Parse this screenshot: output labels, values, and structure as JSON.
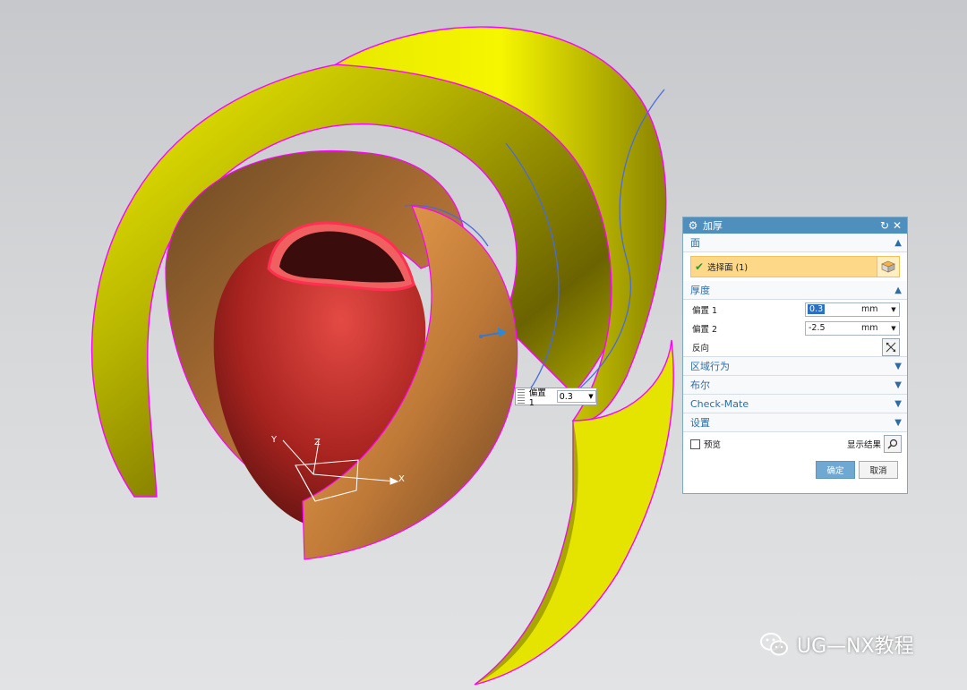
{
  "dialog": {
    "title": "加厚",
    "icons": {
      "title": "gear-icon",
      "reset": "reset-icon",
      "close": "close-icon"
    },
    "section_face": "面",
    "select_face_label": "选择面 (1)",
    "section_thickness": "厚度",
    "offset1_label": "偏置 1",
    "offset1_value": "0.3",
    "offset1_unit": "mm",
    "offset2_label": "偏置 2",
    "offset2_value": "-2.5",
    "offset2_unit": "mm",
    "reverse_label": "反向",
    "section_region": "区域行为",
    "section_boolean": "布尔",
    "section_checkmate": "Check-Mate",
    "section_settings": "设置",
    "preview_label": "预览",
    "show_result_label": "显示结果",
    "ok_label": "确定",
    "cancel_label": "取消"
  },
  "tooltip": {
    "label": "偏置 1",
    "value": "0.3"
  },
  "axes": {
    "x": "X",
    "y": "Y",
    "z": "Z"
  },
  "watermark": {
    "text": "UG—NX教程",
    "icon": "wechat-icon"
  },
  "colors": {
    "surface_yellow": "#e6e600",
    "surface_orange": "#f0a050",
    "surface_red": "#c0302a",
    "edge_magenta": "#ff00ff",
    "curve_blue": "#4a6ae0",
    "dialog_title_bar": "#4f8fbd",
    "selection_highlight": "#fdd889"
  }
}
